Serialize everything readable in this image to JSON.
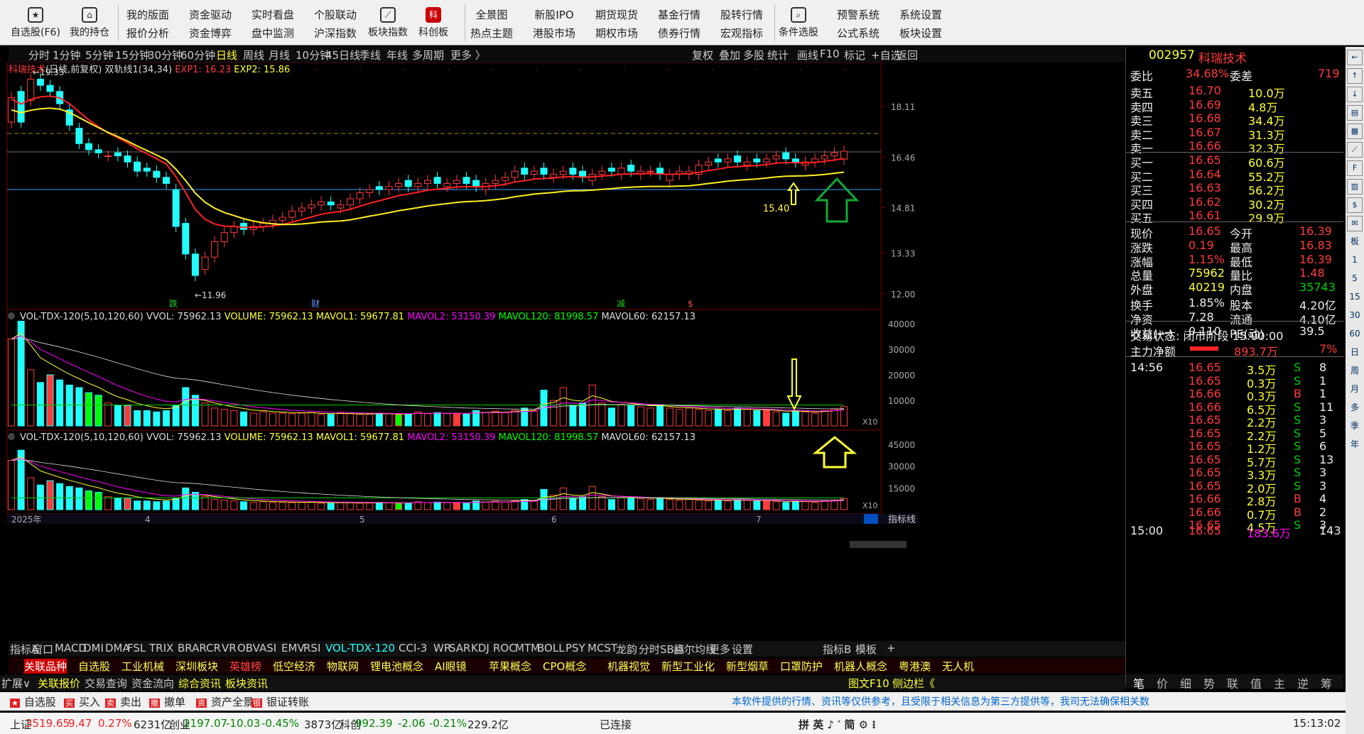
{
  "toolbar": {
    "left_buttons": [
      {
        "label": "自选股(F6)",
        "icon": "star-icon"
      },
      {
        "label": "我的持仓",
        "icon": "home-icon"
      }
    ],
    "pairs": [
      [
        "我的版面",
        "报价分析"
      ],
      [
        "资金驱动",
        "资金博弈"
      ],
      [
        "实时看盘",
        "盘中监测"
      ],
      [
        "个股联动",
        "沪深指数"
      ]
    ],
    "mid_buttons": [
      {
        "label": "板块指数",
        "icon": "chart-icon"
      },
      {
        "label": "科创板",
        "icon": "sci-icon",
        "badge": "NEW"
      }
    ],
    "pairs2": [
      [
        "全景图",
        "热点主题"
      ],
      [
        "新股IPO",
        "港股市场"
      ],
      [
        "期货现货",
        "期权市场"
      ],
      [
        "基金行情",
        "债券行情"
      ],
      [
        "股转行情",
        "宏观指标"
      ]
    ],
    "cond": {
      "label": "条件选股",
      "icon": "search-icon"
    },
    "pairs3": [
      [
        "预警系统",
        "公式系统"
      ],
      [
        "系统设置",
        "板块设置"
      ]
    ]
  },
  "periods": [
    "分时",
    "1分钟",
    "5分钟",
    "15分钟",
    "30分钟",
    "60分钟",
    "日线",
    "周线",
    "月线",
    "10分钟",
    "45日线",
    "季线",
    "年线",
    "多周期",
    "更多"
  ],
  "active_period": "日线",
  "right_tools": [
    "复权",
    "叠加",
    "多股",
    "统计",
    "画线",
    "F10",
    "标记",
    "+自选",
    "返回"
  ],
  "main_legend": {
    "name": "科瑞技术",
    "mode": "(日线,前复权)",
    "indicator": "双轨线1(34,34)",
    "exp1": "EXP1: 16.23",
    "exp2": "EXP2: 15.86"
  },
  "price_axis": [
    "18.11",
    "16.46",
    "14.81",
    "13.33",
    "12.00"
  ],
  "annotations": {
    "high": "19.33",
    "low": "11.96",
    "arrow_value": "15.40"
  },
  "markers": [
    "跌",
    "财",
    "减",
    "$"
  ],
  "vol_legend": {
    "name": "VOL-TDX-120(5,10,120,60)",
    "vvol": "VVOL: 75962.13",
    "volume": "VOLUME: 75962.13",
    "mavol1": "MAVOL1: 59677.81",
    "mavol2": "MAVOL2: 53150.39",
    "mavol120": "MAVOL120: 81998.57",
    "mavol60": "MAVOL60: 62157.13"
  },
  "vol_axis1": [
    "40000",
    "30000",
    "20000",
    "10000"
  ],
  "vol_axis2": [
    "45000",
    "30000",
    "15000"
  ],
  "x10": "X10",
  "date_labels": [
    "2025年",
    "4",
    "5",
    "6",
    "7"
  ],
  "indicators": [
    "指标A",
    "窗口",
    "MACD",
    "DMI",
    "DMA",
    "FSL",
    "TRIX",
    "BRAR",
    "CR",
    "VR",
    "OBV",
    "ASI",
    "EMV",
    "RSI",
    "VOL-TDX-120",
    "CCI-3",
    "WR",
    "SAR",
    "KDJ",
    "ROC",
    "MTM",
    "BOLL",
    "PSY",
    "MCST",
    "龙韵",
    "分时SB点",
    "赫尔均线",
    "更多",
    "设置"
  ],
  "indicator_right": [
    "指标B",
    "模板"
  ],
  "blocks": [
    "关联品种",
    "自选股",
    "工业机械",
    "深圳板块",
    "英雄榜",
    "低空经济",
    "物联网",
    "锂电池概念",
    "AI眼镜",
    "苹果概念",
    "CPO概念",
    "机器视觉",
    "新型工业化",
    "新型烟草",
    "口罩防护",
    "机器人概念",
    "粤港澳",
    "无人机"
  ],
  "tabs": [
    "扩展∨",
    "关联报价",
    "交易查询",
    "资金流向",
    "综合资讯",
    "板块资讯"
  ],
  "tabs_right": [
    "图文F10",
    "侧边栏《"
  ],
  "quote": {
    "code": "002957",
    "name": "科瑞技术",
    "weibi": "34.68%",
    "weicha": "719",
    "sells": [
      [
        "卖五",
        "16.70",
        "10.0万"
      ],
      [
        "卖四",
        "16.69",
        "4.8万"
      ],
      [
        "卖三",
        "16.68",
        "34.4万"
      ],
      [
        "卖二",
        "16.67",
        "31.3万"
      ],
      [
        "卖一",
        "16.66",
        "32.3万"
      ]
    ],
    "buys": [
      [
        "买一",
        "16.65",
        "60.6万"
      ],
      [
        "买二",
        "16.64",
        "55.2万"
      ],
      [
        "买三",
        "16.63",
        "56.2万"
      ],
      [
        "买四",
        "16.62",
        "30.2万"
      ],
      [
        "买五",
        "16.61",
        "29.9万"
      ]
    ],
    "stats": [
      [
        "现价",
        "16.65",
        "今开",
        "16.39"
      ],
      [
        "涨跌",
        "0.19",
        "最高",
        "16.83"
      ],
      [
        "涨幅",
        "1.15%",
        "最低",
        "16.39"
      ],
      [
        "总量",
        "75962",
        "量比",
        "1.48"
      ],
      [
        "外盘",
        "40219",
        "内盘",
        "35743"
      ],
      [
        "换手",
        "1.85%",
        "股本",
        "4.20亿"
      ],
      [
        "净资",
        "7.28",
        "流通",
        "4.10亿"
      ],
      [
        "收益(一)",
        "0.110",
        "PE(动)",
        "39.5"
      ]
    ],
    "status": "交易状态: 闭市阶段 15:00:00",
    "main_flow": [
      "主力净额",
      "893.7万",
      "7%"
    ],
    "ticks": [
      [
        "14:56",
        "16.65",
        "3.5万",
        "S",
        "8"
      ],
      [
        "",
        "16.65",
        "0.3万",
        "S",
        "1"
      ],
      [
        "",
        "16.66",
        "0.3万",
        "B",
        "1"
      ],
      [
        "",
        "16.66",
        "6.5万",
        "S",
        "11"
      ],
      [
        "",
        "16.65",
        "2.2万",
        "S",
        "3"
      ],
      [
        "",
        "16.65",
        "2.2万",
        "S",
        "5"
      ],
      [
        "",
        "16.65",
        "1.2万",
        "S",
        "6"
      ],
      [
        "",
        "16.65",
        "5.7万",
        "S",
        "13"
      ],
      [
        "",
        "16.65",
        "3.3万",
        "S",
        "3"
      ],
      [
        "",
        "16.65",
        "2.0万",
        "S",
        "3"
      ],
      [
        "",
        "16.66",
        "2.8万",
        "B",
        "4"
      ],
      [
        "",
        "16.66",
        "0.7万",
        "B",
        "2"
      ],
      [
        "",
        "16.65",
        "4.5万",
        "S",
        "3"
      ],
      [
        "15:00",
        "16.65",
        "183.6万",
        "",
        "143"
      ]
    ],
    "bottom_tabs": [
      "笔",
      "价",
      "细",
      "势",
      "联",
      "值",
      "主",
      "逆",
      "筹"
    ]
  },
  "order": [
    "自选股",
    "买入",
    "卖出",
    "撤单",
    "资产全景",
    "银证转账"
  ],
  "disclaimer": "本软件提供的行情、资讯等仅供参考，且受限于相关信息为第三方提供等，我司无法确保相关数",
  "indices": {
    "sh_label": "上证",
    "sh": "3519.65",
    "sh_chg": "9.47",
    "sh_pct": "0.27%",
    "sh_amt": "6231亿",
    "cy_label": "创业",
    "cy": "2197.07",
    "cy_chg": "-10.03",
    "cy_pct": "-0.45%",
    "cy_amt": "3873亿",
    "kc_label": "科创",
    "kc": "992.39",
    "kc_chg": "-2.06",
    "kc_pct": "-0.21%",
    "kc_amt": "229.2亿"
  },
  "connected": "已连接",
  "ime": "拼 英 ♪ ′ 简 ⚙ ⁝",
  "time": "15:13:02",
  "far_right_icons": [
    "left-arrow-icon",
    "up-arrow-icon",
    "down-arrow-icon",
    "list-icon",
    "grid-icon",
    "chart-icon",
    "f10-icon",
    "doc-icon",
    "fund-icon",
    "news-icon"
  ]
}
